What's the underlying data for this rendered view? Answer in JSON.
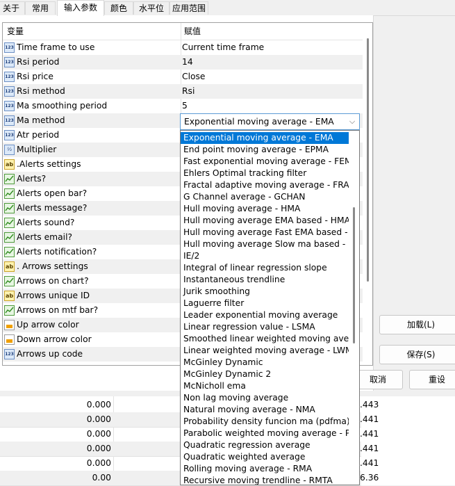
{
  "tabs": [
    "关于",
    "常用",
    "输入参数",
    "颜色",
    "水平位",
    "应用范围"
  ],
  "table": {
    "headers": [
      "变量",
      "赋值"
    ],
    "rows": [
      {
        "icon": "123",
        "name": "Time frame to use",
        "value": "Current time frame"
      },
      {
        "icon": "123",
        "name": "Rsi period",
        "value": "14"
      },
      {
        "icon": "123",
        "name": "Rsi price",
        "value": "Close"
      },
      {
        "icon": "123",
        "name": "Rsi method",
        "value": "Rsi"
      },
      {
        "icon": "123",
        "name": "Ma smoothing period",
        "value": "5"
      },
      {
        "icon": "123",
        "name": "Ma method",
        "value": ""
      },
      {
        "icon": "123",
        "name": "Atr period",
        "value": ""
      },
      {
        "icon": "dbl",
        "name": "Multiplier",
        "value": ""
      },
      {
        "icon": "ab",
        "name": ".Alerts settings",
        "value": ""
      },
      {
        "icon": "bool",
        "name": "Alerts?",
        "value": ""
      },
      {
        "icon": "bool",
        "name": "Alerts open bar?",
        "value": ""
      },
      {
        "icon": "bool",
        "name": "Alerts message?",
        "value": ""
      },
      {
        "icon": "bool",
        "name": "Alerts sound?",
        "value": ""
      },
      {
        "icon": "bool",
        "name": "Alerts email?",
        "value": ""
      },
      {
        "icon": "bool",
        "name": "Alerts notification?",
        "value": ""
      },
      {
        "icon": "ab",
        "name": ". Arrows settings",
        "value": ""
      },
      {
        "icon": "bool",
        "name": "Arrows on chart?",
        "value": ""
      },
      {
        "icon": "ab",
        "name": "Arrows unique ID",
        "value": ""
      },
      {
        "icon": "bool",
        "name": "Arrows on mtf bar?",
        "value": ""
      },
      {
        "icon": "color",
        "name": "Up arrow color",
        "value": ""
      },
      {
        "icon": "color",
        "name": "Down arrow color",
        "value": ""
      },
      {
        "icon": "123",
        "name": "Arrows up code",
        "value": ""
      }
    ]
  },
  "combo": {
    "value": "Exponential moving average - EMA"
  },
  "dropdown": {
    "selected_index": 0,
    "options": [
      "Exponential moving average - EMA",
      "End point moving average - EPMA",
      "Fast exponential moving average - FEMA",
      "Ehlers Optimal tracking filter",
      "Fractal adaptive moving average - FRAMA",
      "G Channel average - GCHAN",
      "Hull moving average - HMA",
      "Hull moving average EMA based - HMAe",
      "Hull moving average Fast EMA based - H",
      "Hull moving average Slow ma based - HI",
      "IE/2",
      "Integral of linear regression slope",
      "Instantaneous trendline",
      "Jurik smoothing",
      "Laguerre filter",
      "Leader exponential moving average",
      "Linear regression value - LSMA",
      "Smoothed linear weighted moving avera",
      "Linear weighted moving average - LWMA",
      "McGinley Dynamic",
      "McGinley Dynamic 2",
      "McNicholl ema",
      "Non lag moving average",
      "Natural moving average - NMA",
      "Probability density funcion ma (pdfma)",
      "Parabolic weighted moving average - PW",
      "Quadratic regression average",
      "Quadratic weighted average",
      "Rolling moving average - RMA",
      "Recursive moving trendline - RMTA"
    ]
  },
  "buttons": {
    "load": "加载(L)",
    "save": "保存(S)",
    "cancel": "取消",
    "reset": "重设"
  },
  "bottom": {
    "left_values": [
      "0.000",
      "0.000",
      "0.000",
      "0.000",
      "0.000",
      "0.00"
    ],
    "right_values": [
      ".443",
      ".441",
      ".441",
      ".441",
      ".441",
      "6.36"
    ]
  }
}
